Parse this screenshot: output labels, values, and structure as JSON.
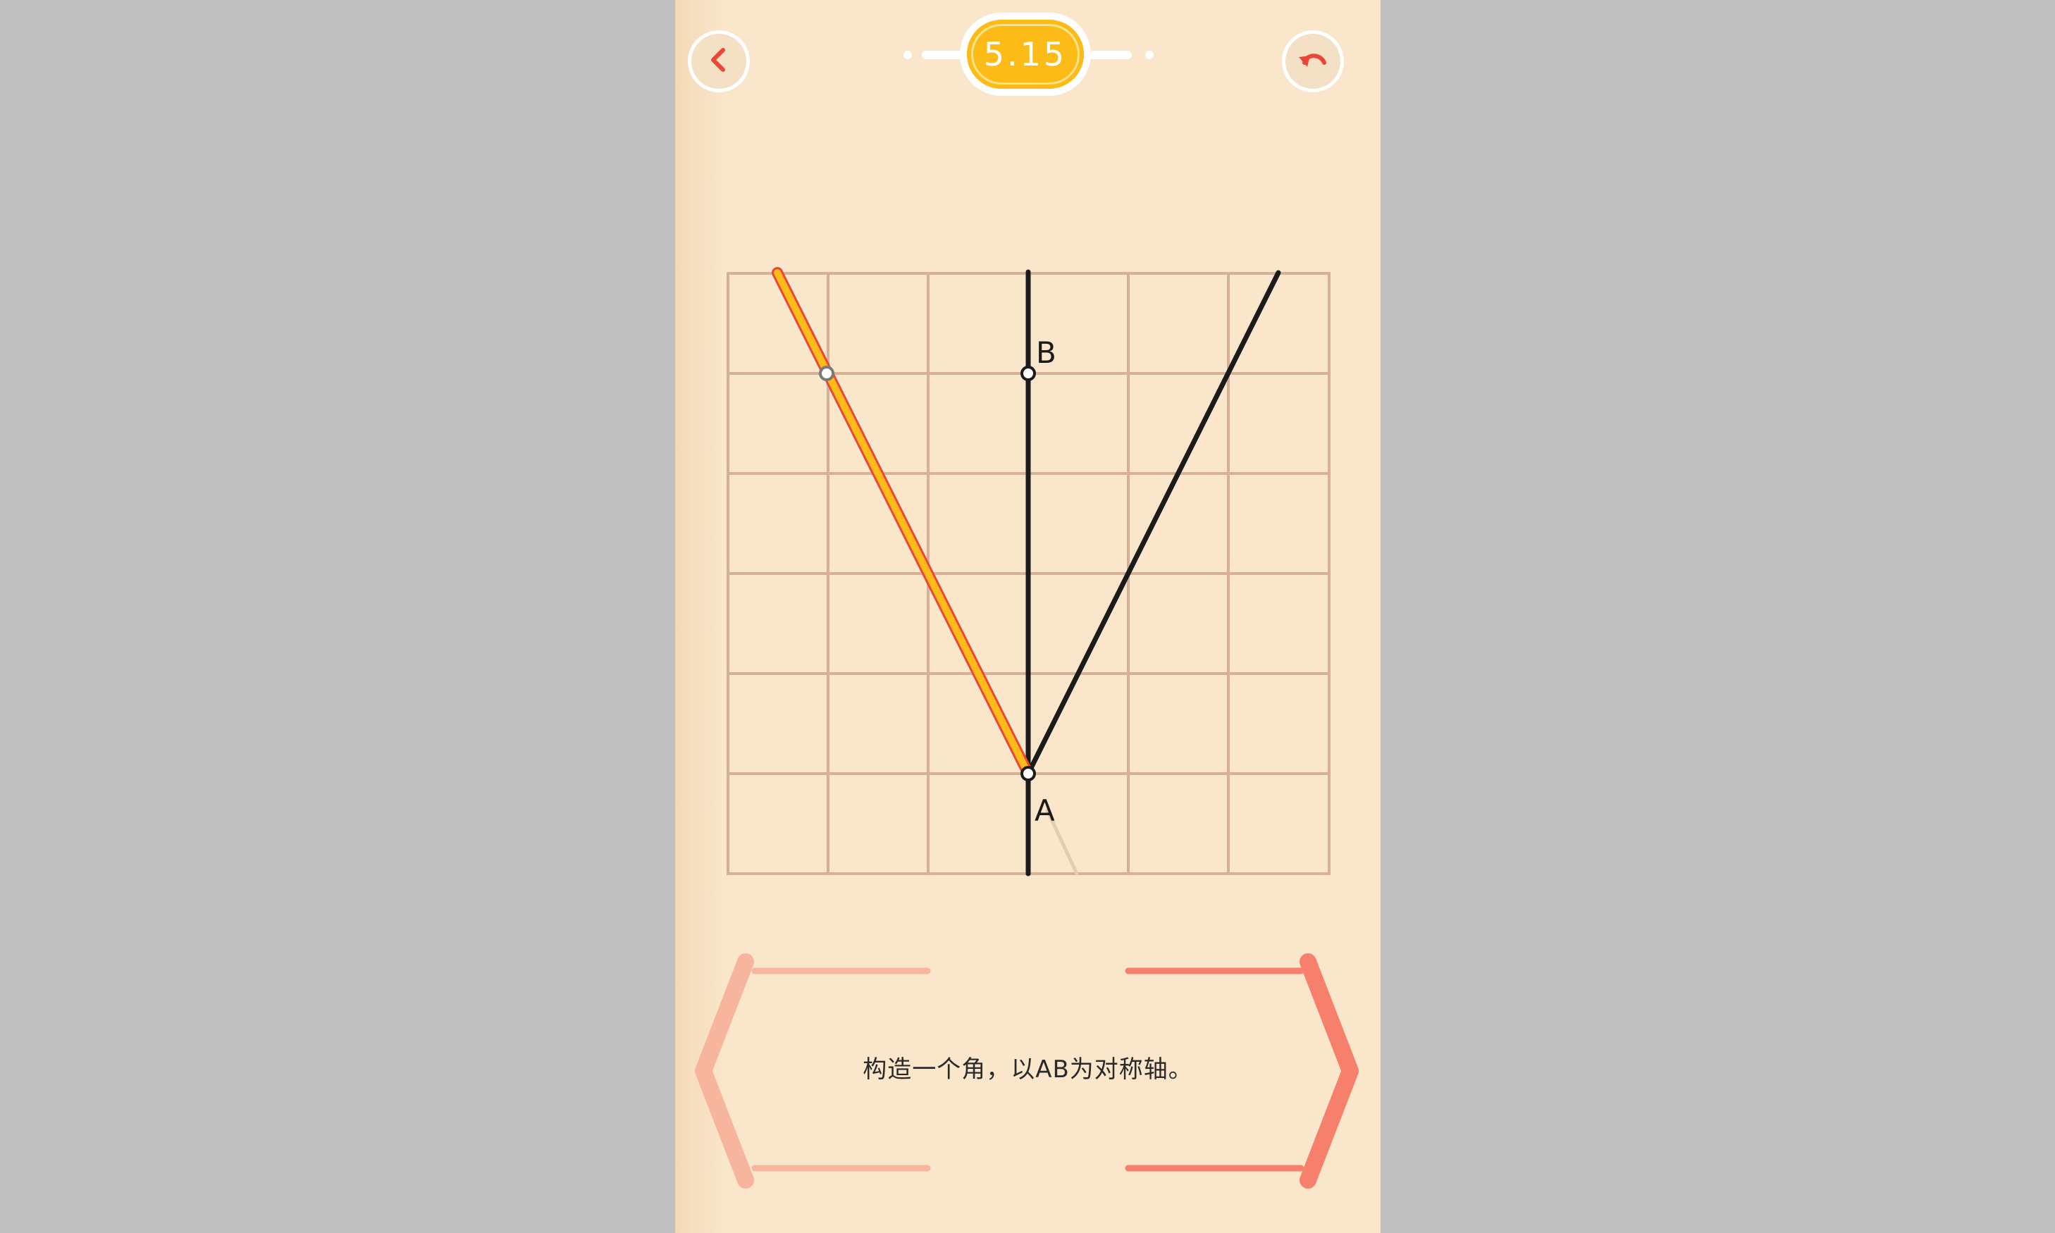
{
  "header": {
    "level": "5.15",
    "back_icon": "chevron-left-icon",
    "undo_icon": "undo-icon"
  },
  "board": {
    "grid": {
      "columns": 6,
      "rows": 6
    },
    "point_labels": {
      "a": "A",
      "b": "B"
    }
  },
  "instruction": "构造一个角，以AB为对称轴。",
  "colors": {
    "background": "#fae6cb",
    "grid": "#d6b196",
    "accent_red": "#e8473a",
    "level_gold": "#fcbb16",
    "active_line": "#fcbb16",
    "bracket_left": "#f7b59d",
    "bracket_right": "#f6806b"
  }
}
